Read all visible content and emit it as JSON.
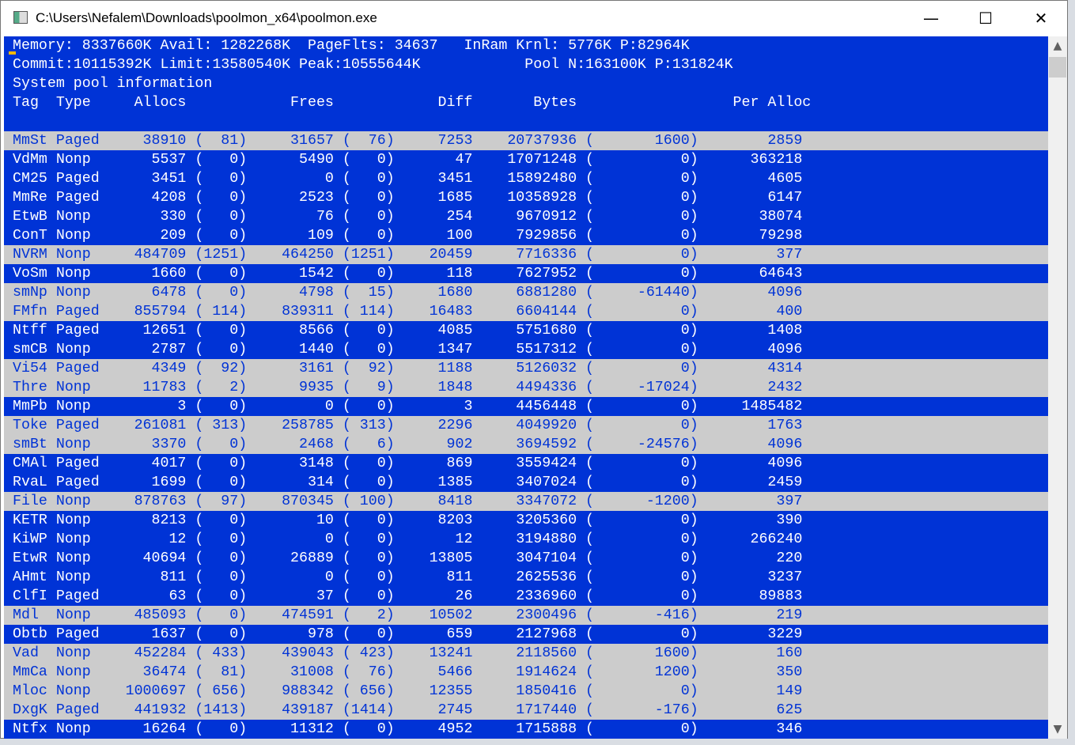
{
  "window": {
    "title": "C:\\Users\\Nefalem\\Downloads\\poolmon_x64\\poolmon.exe",
    "minimize": "—",
    "maximize": "☐",
    "close": "✕"
  },
  "summary": {
    "memory": "Memory: 8337660K Avail: 1282268K  PageFlts: 34637",
    "inram": "InRam Krnl: 5776K P:82964K",
    "commit": "Commit:10115392K Limit:13580540K Peak:10555644K",
    "pool": "Pool N:163100K P:131824K",
    "section": "System pool information"
  },
  "headers": {
    "tag": "Tag",
    "type": "Type",
    "allocs": "Allocs",
    "frees": "Frees",
    "diff": "Diff",
    "bytes": "Bytes",
    "per_alloc": "Per Alloc"
  },
  "colors": {
    "background": "#0033d6",
    "highlight": "#cccccc"
  },
  "rows": [
    {
      "tag": "MmSt",
      "type": "Paged",
      "allocs": "38910",
      "allocs_d": "81",
      "frees": "31657",
      "frees_d": "76",
      "diff": "7253",
      "bytes": "20737936",
      "bytes_d": "1600",
      "per_alloc": "2859",
      "hl": true
    },
    {
      "tag": "VdMm",
      "type": "Nonp",
      "allocs": "5537",
      "allocs_d": "0",
      "frees": "5490",
      "frees_d": "0",
      "diff": "47",
      "bytes": "17071248",
      "bytes_d": "0",
      "per_alloc": "363218",
      "hl": false
    },
    {
      "tag": "CM25",
      "type": "Paged",
      "allocs": "3451",
      "allocs_d": "0",
      "frees": "0",
      "frees_d": "0",
      "diff": "3451",
      "bytes": "15892480",
      "bytes_d": "0",
      "per_alloc": "4605",
      "hl": false
    },
    {
      "tag": "MmRe",
      "type": "Paged",
      "allocs": "4208",
      "allocs_d": "0",
      "frees": "2523",
      "frees_d": "0",
      "diff": "1685",
      "bytes": "10358928",
      "bytes_d": "0",
      "per_alloc": "6147",
      "hl": false
    },
    {
      "tag": "EtwB",
      "type": "Nonp",
      "allocs": "330",
      "allocs_d": "0",
      "frees": "76",
      "frees_d": "0",
      "diff": "254",
      "bytes": "9670912",
      "bytes_d": "0",
      "per_alloc": "38074",
      "hl": false
    },
    {
      "tag": "ConT",
      "type": "Nonp",
      "allocs": "209",
      "allocs_d": "0",
      "frees": "109",
      "frees_d": "0",
      "diff": "100",
      "bytes": "7929856",
      "bytes_d": "0",
      "per_alloc": "79298",
      "hl": false
    },
    {
      "tag": "NVRM",
      "type": "Nonp",
      "allocs": "484709",
      "allocs_d": "1251",
      "frees": "464250",
      "frees_d": "1251",
      "diff": "20459",
      "bytes": "7716336",
      "bytes_d": "0",
      "per_alloc": "377",
      "hl": true
    },
    {
      "tag": "VoSm",
      "type": "Nonp",
      "allocs": "1660",
      "allocs_d": "0",
      "frees": "1542",
      "frees_d": "0",
      "diff": "118",
      "bytes": "7627952",
      "bytes_d": "0",
      "per_alloc": "64643",
      "hl": false
    },
    {
      "tag": "smNp",
      "type": "Nonp",
      "allocs": "6478",
      "allocs_d": "0",
      "frees": "4798",
      "frees_d": "15",
      "diff": "1680",
      "bytes": "6881280",
      "bytes_d": "-61440",
      "per_alloc": "4096",
      "hl": true
    },
    {
      "tag": "FMfn",
      "type": "Paged",
      "allocs": "855794",
      "allocs_d": "114",
      "frees": "839311",
      "frees_d": "114",
      "diff": "16483",
      "bytes": "6604144",
      "bytes_d": "0",
      "per_alloc": "400",
      "hl": true
    },
    {
      "tag": "Ntff",
      "type": "Paged",
      "allocs": "12651",
      "allocs_d": "0",
      "frees": "8566",
      "frees_d": "0",
      "diff": "4085",
      "bytes": "5751680",
      "bytes_d": "0",
      "per_alloc": "1408",
      "hl": false
    },
    {
      "tag": "smCB",
      "type": "Nonp",
      "allocs": "2787",
      "allocs_d": "0",
      "frees": "1440",
      "frees_d": "0",
      "diff": "1347",
      "bytes": "5517312",
      "bytes_d": "0",
      "per_alloc": "4096",
      "hl": false
    },
    {
      "tag": "Vi54",
      "type": "Paged",
      "allocs": "4349",
      "allocs_d": "92",
      "frees": "3161",
      "frees_d": "92",
      "diff": "1188",
      "bytes": "5126032",
      "bytes_d": "0",
      "per_alloc": "4314",
      "hl": true
    },
    {
      "tag": "Thre",
      "type": "Nonp",
      "allocs": "11783",
      "allocs_d": "2",
      "frees": "9935",
      "frees_d": "9",
      "diff": "1848",
      "bytes": "4494336",
      "bytes_d": "-17024",
      "per_alloc": "2432",
      "hl": true
    },
    {
      "tag": "MmPb",
      "type": "Nonp",
      "allocs": "3",
      "allocs_d": "0",
      "frees": "0",
      "frees_d": "0",
      "diff": "3",
      "bytes": "4456448",
      "bytes_d": "0",
      "per_alloc": "1485482",
      "hl": false
    },
    {
      "tag": "Toke",
      "type": "Paged",
      "allocs": "261081",
      "allocs_d": "313",
      "frees": "258785",
      "frees_d": "313",
      "diff": "2296",
      "bytes": "4049920",
      "bytes_d": "0",
      "per_alloc": "1763",
      "hl": true
    },
    {
      "tag": "smBt",
      "type": "Nonp",
      "allocs": "3370",
      "allocs_d": "0",
      "frees": "2468",
      "frees_d": "6",
      "diff": "902",
      "bytes": "3694592",
      "bytes_d": "-24576",
      "per_alloc": "4096",
      "hl": true
    },
    {
      "tag": "CMAl",
      "type": "Paged",
      "allocs": "4017",
      "allocs_d": "0",
      "frees": "3148",
      "frees_d": "0",
      "diff": "869",
      "bytes": "3559424",
      "bytes_d": "0",
      "per_alloc": "4096",
      "hl": false
    },
    {
      "tag": "RvaL",
      "type": "Paged",
      "allocs": "1699",
      "allocs_d": "0",
      "frees": "314",
      "frees_d": "0",
      "diff": "1385",
      "bytes": "3407024",
      "bytes_d": "0",
      "per_alloc": "2459",
      "hl": false
    },
    {
      "tag": "File",
      "type": "Nonp",
      "allocs": "878763",
      "allocs_d": "97",
      "frees": "870345",
      "frees_d": "100",
      "diff": "8418",
      "bytes": "3347072",
      "bytes_d": "-1200",
      "per_alloc": "397",
      "hl": true
    },
    {
      "tag": "KETR",
      "type": "Nonp",
      "allocs": "8213",
      "allocs_d": "0",
      "frees": "10",
      "frees_d": "0",
      "diff": "8203",
      "bytes": "3205360",
      "bytes_d": "0",
      "per_alloc": "390",
      "hl": false
    },
    {
      "tag": "KiWP",
      "type": "Nonp",
      "allocs": "12",
      "allocs_d": "0",
      "frees": "0",
      "frees_d": "0",
      "diff": "12",
      "bytes": "3194880",
      "bytes_d": "0",
      "per_alloc": "266240",
      "hl": false
    },
    {
      "tag": "EtwR",
      "type": "Nonp",
      "allocs": "40694",
      "allocs_d": "0",
      "frees": "26889",
      "frees_d": "0",
      "diff": "13805",
      "bytes": "3047104",
      "bytes_d": "0",
      "per_alloc": "220",
      "hl": false
    },
    {
      "tag": "AHmt",
      "type": "Nonp",
      "allocs": "811",
      "allocs_d": "0",
      "frees": "0",
      "frees_d": "0",
      "diff": "811",
      "bytes": "2625536",
      "bytes_d": "0",
      "per_alloc": "3237",
      "hl": false
    },
    {
      "tag": "ClfI",
      "type": "Paged",
      "allocs": "63",
      "allocs_d": "0",
      "frees": "37",
      "frees_d": "0",
      "diff": "26",
      "bytes": "2336960",
      "bytes_d": "0",
      "per_alloc": "89883",
      "hl": false
    },
    {
      "tag": "Mdl",
      "type": "Nonp",
      "allocs": "485093",
      "allocs_d": "0",
      "frees": "474591",
      "frees_d": "2",
      "diff": "10502",
      "bytes": "2300496",
      "bytes_d": "-416",
      "per_alloc": "219",
      "hl": true
    },
    {
      "tag": "Obtb",
      "type": "Paged",
      "allocs": "1637",
      "allocs_d": "0",
      "frees": "978",
      "frees_d": "0",
      "diff": "659",
      "bytes": "2127968",
      "bytes_d": "0",
      "per_alloc": "3229",
      "hl": false
    },
    {
      "tag": "Vad",
      "type": "Nonp",
      "allocs": "452284",
      "allocs_d": "433",
      "frees": "439043",
      "frees_d": "423",
      "diff": "13241",
      "bytes": "2118560",
      "bytes_d": "1600",
      "per_alloc": "160",
      "hl": true
    },
    {
      "tag": "MmCa",
      "type": "Nonp",
      "allocs": "36474",
      "allocs_d": "81",
      "frees": "31008",
      "frees_d": "76",
      "diff": "5466",
      "bytes": "1914624",
      "bytes_d": "1200",
      "per_alloc": "350",
      "hl": true
    },
    {
      "tag": "Mloc",
      "type": "Nonp",
      "allocs": "1000697",
      "allocs_d": "656",
      "frees": "988342",
      "frees_d": "656",
      "diff": "12355",
      "bytes": "1850416",
      "bytes_d": "0",
      "per_alloc": "149",
      "hl": true
    },
    {
      "tag": "DxgK",
      "type": "Paged",
      "allocs": "441932",
      "allocs_d": "1413",
      "frees": "439187",
      "frees_d": "1414",
      "diff": "2745",
      "bytes": "1717440",
      "bytes_d": "-176",
      "per_alloc": "625",
      "hl": true
    },
    {
      "tag": "Ntfx",
      "type": "Nonp",
      "allocs": "16264",
      "allocs_d": "0",
      "frees": "11312",
      "frees_d": "0",
      "diff": "4952",
      "bytes": "1715888",
      "bytes_d": "0",
      "per_alloc": "346",
      "hl": false
    }
  ]
}
